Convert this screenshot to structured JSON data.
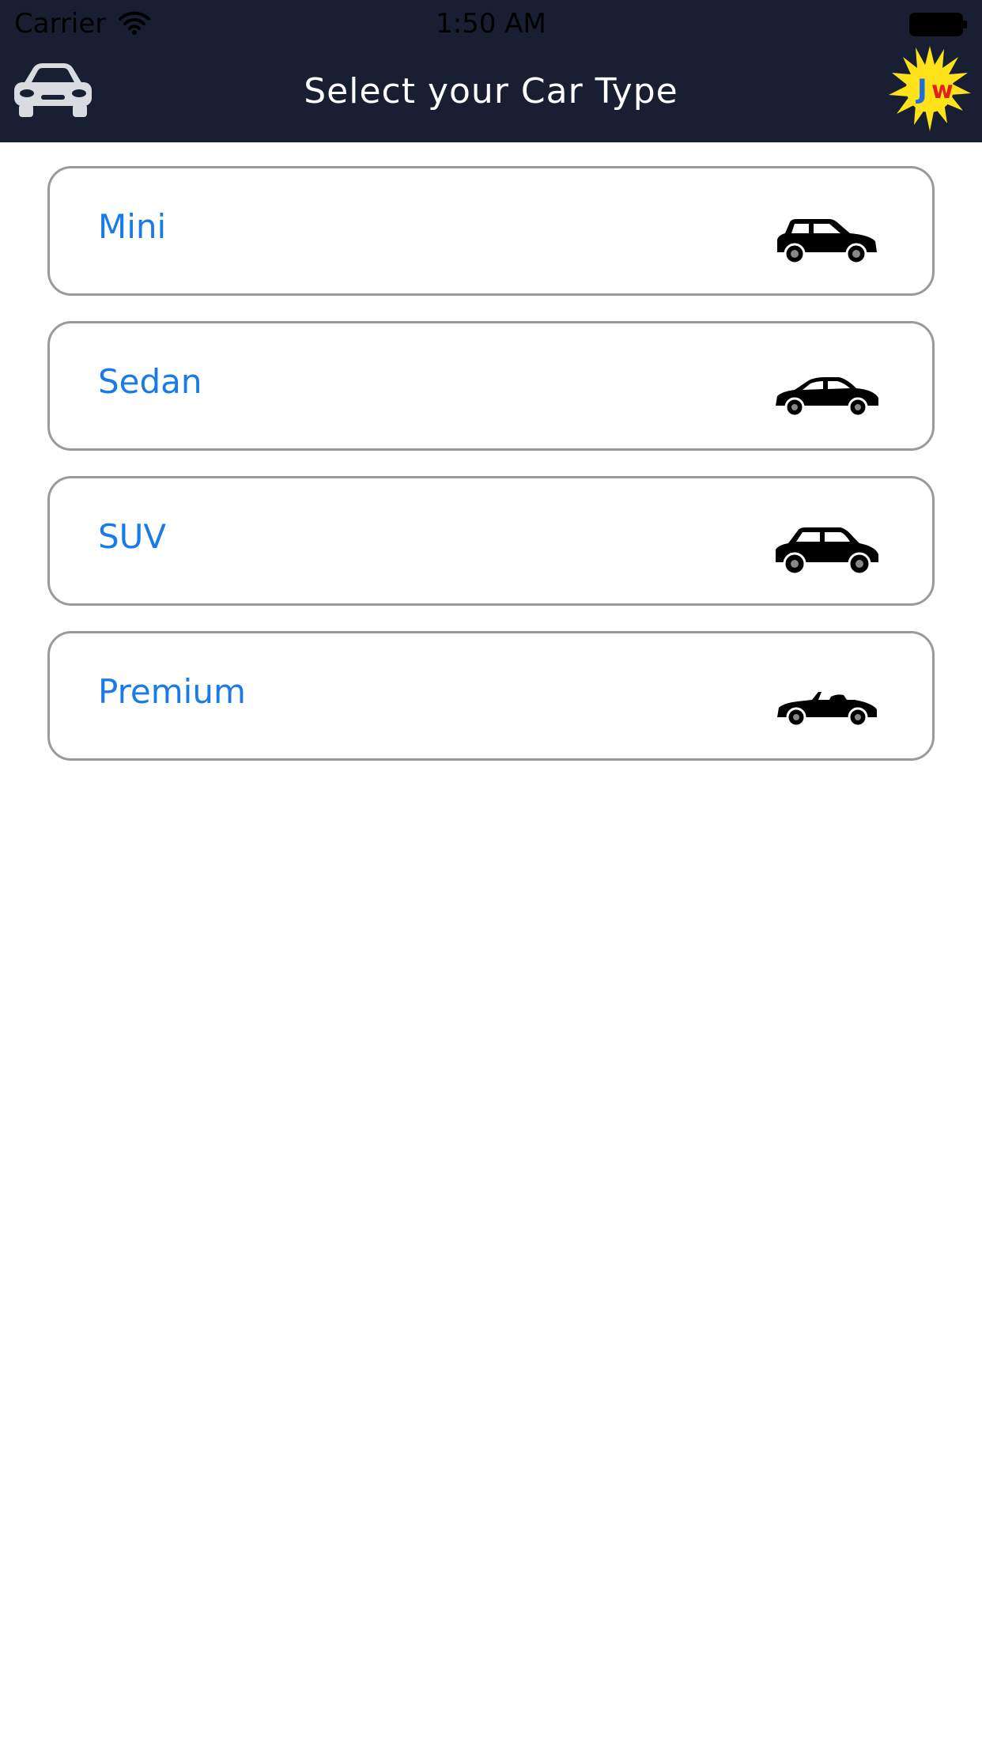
{
  "status_bar": {
    "carrier": "Carrier",
    "time": "1:50 AM",
    "wifi_icon": "wifi-icon",
    "battery_icon": "battery-icon"
  },
  "nav_bar": {
    "title": "Select your Car Type",
    "left_icon": "car-front-icon",
    "right_logo": "jw-logo",
    "logo_text": "Jw"
  },
  "car_types": [
    {
      "label": "Mini",
      "icon": "hatchback-car-icon"
    },
    {
      "label": "Sedan",
      "icon": "sedan-car-icon"
    },
    {
      "label": "SUV",
      "icon": "suv-car-icon"
    },
    {
      "label": "Premium",
      "icon": "convertible-car-icon"
    }
  ],
  "colors": {
    "header_bg": "#181f33",
    "label_blue": "#1a7ae8",
    "card_border": "#9a9a9a",
    "logo_yellow": "#ffe21a"
  }
}
